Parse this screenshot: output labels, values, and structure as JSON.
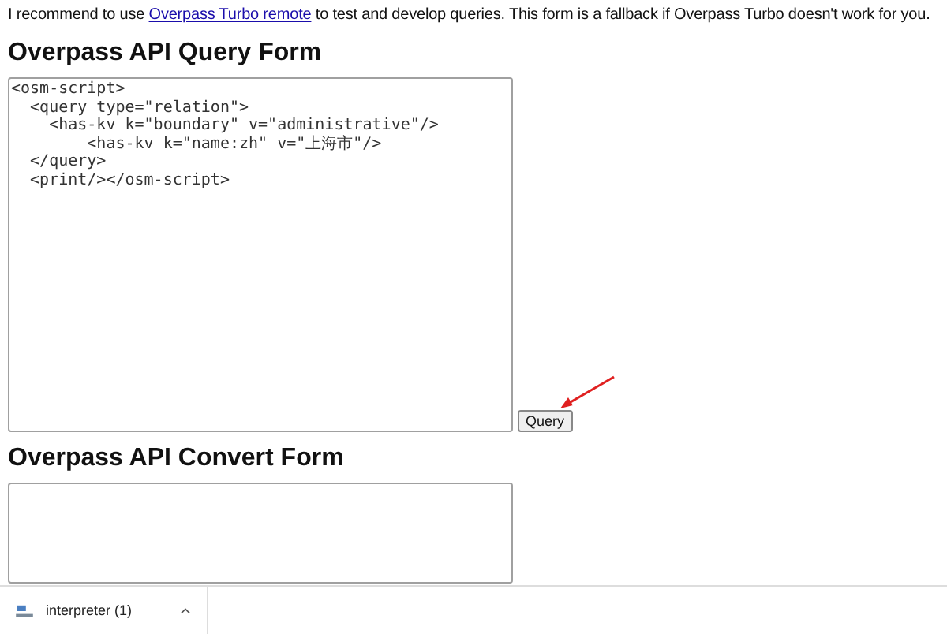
{
  "intro": {
    "before": "I recommend to use ",
    "link": "Overpass Turbo remote",
    "after": " to test and develop queries. This form is a fallback if Overpass Turbo doesn't work for you."
  },
  "query_form": {
    "title": "Overpass API Query Form",
    "query": "<osm-script>\n  <query type=\"relation\">\n    <has-kv k=\"boundary\" v=\"administrative\"/>\n        <has-kv k=\"name:zh\" v=\"上海市\"/>\n  </query>\n  <print/></osm-script>",
    "button": "Query"
  },
  "convert_form": {
    "title": "Overpass API Convert Form"
  },
  "download_bar": {
    "items": [
      {
        "name": "interpreter (1)"
      }
    ]
  }
}
